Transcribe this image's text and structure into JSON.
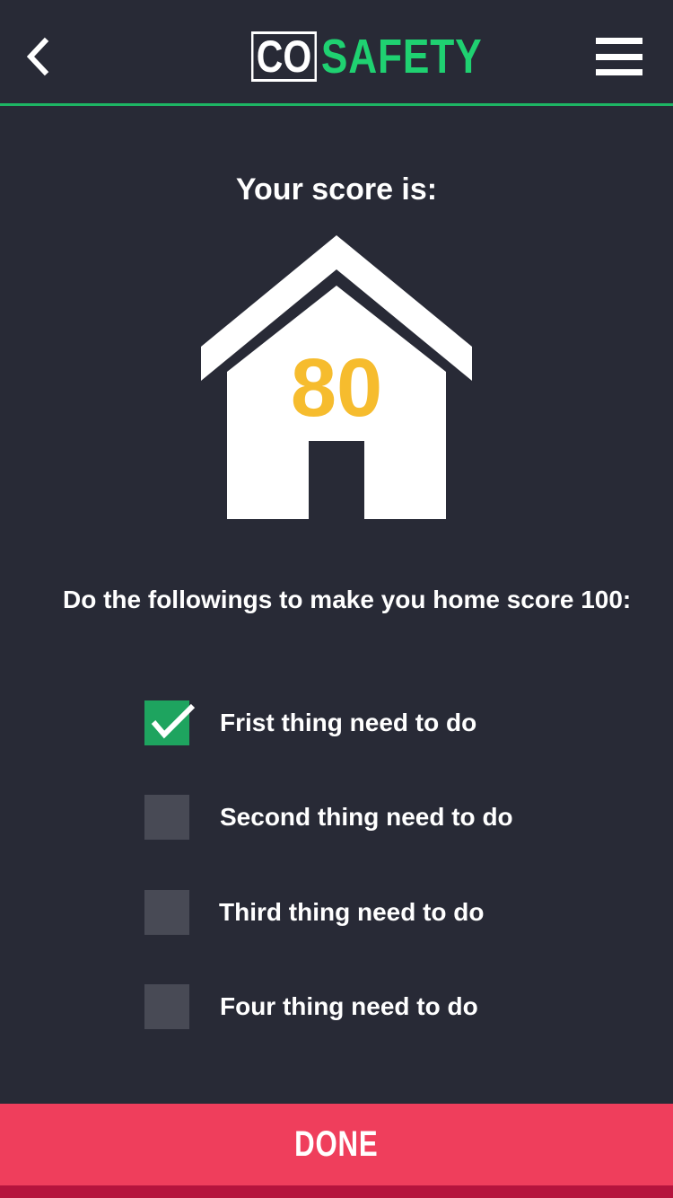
{
  "header": {
    "logo_co": "CO",
    "logo_safety": "SAFETY",
    "back_icon": "chevron-left-icon",
    "menu_icon": "hamburger-menu-icon"
  },
  "score": {
    "heading": "Your score is:",
    "value": "80"
  },
  "instructions": "Do the followings to make you home score 100:",
  "tasks": [
    {
      "label": "Frist thing need to do",
      "checked": true
    },
    {
      "label": "Second thing need to do",
      "checked": false
    },
    {
      "label": "Third thing need to do",
      "checked": false
    },
    {
      "label": "Four thing need to do",
      "checked": false
    }
  ],
  "done_label": "DONE",
  "colors": {
    "background": "#282a36",
    "accent_green": "#1db564",
    "score_yellow": "#f6bc2e",
    "done_red": "#ef3e5c"
  }
}
